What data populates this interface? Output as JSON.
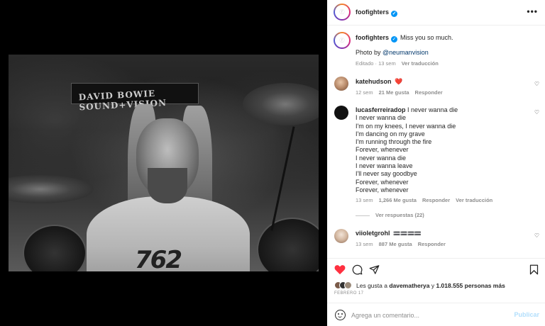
{
  "post": {
    "username": "foofighters",
    "more_label": "•••"
  },
  "caption": {
    "username": "foofighters",
    "text": "Miss you so much.",
    "photo_by_prefix": "Photo by ",
    "photo_by_mention": "@neumanvision",
    "meta_edited": "Editado · 13 sem",
    "meta_translate": "Ver traducción"
  },
  "photo": {
    "poster_text": "DAVID BOWIE SOUND+VISION",
    "shirt_text": "762"
  },
  "comments": [
    {
      "username": "katehudson",
      "text": "❤️",
      "time": "12 sem",
      "likes": "21 Me gusta",
      "reply": "Responder"
    },
    {
      "username": "lucasferreiradop",
      "lines": [
        "I never wanna die",
        "I never wanna die",
        "I'm on my knees, I never wanna die",
        "I'm dancing on my grave",
        "I'm running through the fire",
        "Forever, whenever",
        "I never wanna die",
        "I never wanna leave",
        "I'll never say goodbye",
        "Forever, whenever",
        "Forever, whenever"
      ],
      "time": "13 sem",
      "likes": "1,266 Me gusta",
      "reply": "Responder",
      "translate": "Ver traducción",
      "view_replies": "Ver respuestas (22)"
    },
    {
      "username": "viioletgrohl",
      "text": "🟰🟰🟰🟰",
      "time": "13 sem",
      "likes": "887 Me gusta",
      "reply": "Responder"
    }
  ],
  "likes": {
    "prefix": "Les gusta a ",
    "user": "davematherya",
    "middle": " y ",
    "count": "1.018.555 personas más"
  },
  "date": "FEBRERO 17",
  "add_comment": {
    "placeholder": "Agrega un comentario...",
    "publish": "Publicar"
  },
  "colors": {
    "verified": "#0095f6",
    "like_red": "#ff3040",
    "publish_disabled": "#b2dffc",
    "mention": "#00376b",
    "meta_grey": "#8e8e8e"
  }
}
